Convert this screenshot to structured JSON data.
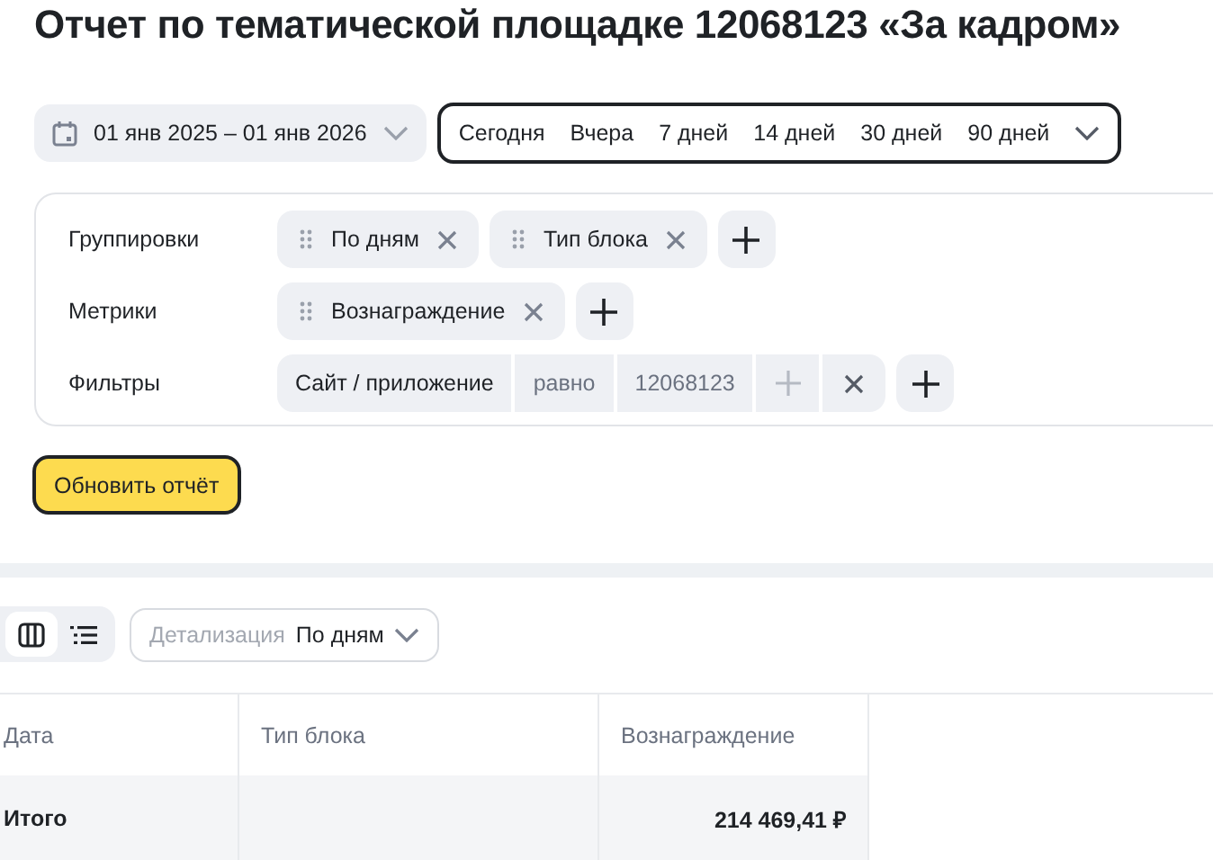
{
  "title": "Отчет по тематической площадке 12068123 «За кадром»",
  "date_range": {
    "value": "01 янв 2025 – 01 янв 2026"
  },
  "periods": [
    "Сегодня",
    "Вчера",
    "7 дней",
    "14 дней",
    "30 дней",
    "90 дней"
  ],
  "settings": [
    {
      "label": "Группировки",
      "kind": "chips",
      "chips": [
        "По дням",
        "Тип блока"
      ]
    },
    {
      "label": "Метрики",
      "kind": "chips",
      "chips": [
        "Вознаграждение"
      ]
    },
    {
      "label": "Фильтры",
      "kind": "filter",
      "field": "Сайт / приложение",
      "operator": "равно",
      "value": "12068123"
    }
  ],
  "refresh_button": "Обновить отчёт",
  "view_toggle": [
    {
      "kind": "columns",
      "selected": true
    },
    {
      "kind": "list",
      "selected": false
    }
  ],
  "detail": {
    "label": "Детализация",
    "value": "По дням"
  },
  "table": {
    "columns": [
      "Дата",
      "Тип блока",
      "Вознаграждение"
    ],
    "rows": [
      {
        "cells": [
          "Итого",
          "",
          "214 469,41 ₽"
        ],
        "total": true
      }
    ]
  }
}
